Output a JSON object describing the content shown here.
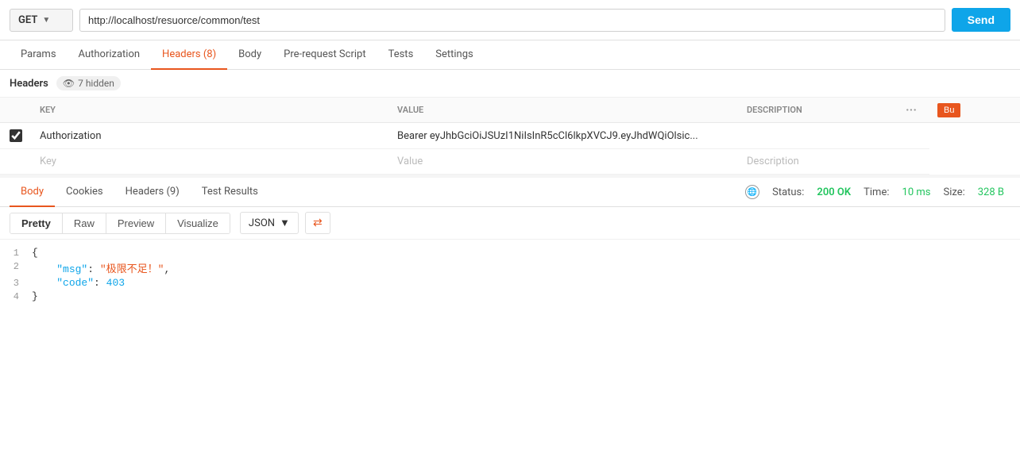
{
  "urlBar": {
    "method": "GET",
    "url": "http://localhost/resuorce/common/test",
    "sendLabel": "Send"
  },
  "requestTabs": {
    "tabs": [
      {
        "id": "params",
        "label": "Params"
      },
      {
        "id": "authorization",
        "label": "Authorization"
      },
      {
        "id": "headers",
        "label": "Headers (8)"
      },
      {
        "id": "body",
        "label": "Body"
      },
      {
        "id": "prerequest",
        "label": "Pre-request Script"
      },
      {
        "id": "tests",
        "label": "Tests"
      },
      {
        "id": "settings",
        "label": "Settings"
      }
    ],
    "activeTab": "headers"
  },
  "headersSection": {
    "title": "Headers",
    "hiddenCount": "7 hidden",
    "columns": {
      "key": "KEY",
      "value": "VALUE",
      "description": "DESCRIPTION"
    },
    "rows": [
      {
        "checked": true,
        "key": "Authorization",
        "value": "Bearer eyJhbGciOiJSUzI1NiIsInR5cCl6lkpXVCJ9.eyJhdWQiOlsic...",
        "description": ""
      }
    ],
    "placeholderRow": {
      "key": "Key",
      "value": "Value",
      "description": "Description"
    }
  },
  "responseTabs": {
    "tabs": [
      {
        "id": "body",
        "label": "Body"
      },
      {
        "id": "cookies",
        "label": "Cookies"
      },
      {
        "id": "headers",
        "label": "Headers (9)"
      },
      {
        "id": "testresults",
        "label": "Test Results"
      }
    ],
    "activeTab": "body",
    "status": {
      "label": "Status:",
      "value": "200 OK",
      "timeLabel": "Time:",
      "timeValue": "10 ms",
      "sizeLabel": "Size:",
      "sizeValue": "328 B"
    }
  },
  "formatToolbar": {
    "buttons": [
      "Pretty",
      "Raw",
      "Preview",
      "Visualize"
    ],
    "activeButton": "Pretty",
    "format": "JSON",
    "wrapIcon": "⇄"
  },
  "codeContent": {
    "lines": [
      {
        "num": "1",
        "content": "{"
      },
      {
        "num": "2",
        "content": "    \"msg\": \"极限不足！\","
      },
      {
        "num": "3",
        "content": "    \"code\": 403"
      },
      {
        "num": "4",
        "content": "}"
      }
    ]
  }
}
